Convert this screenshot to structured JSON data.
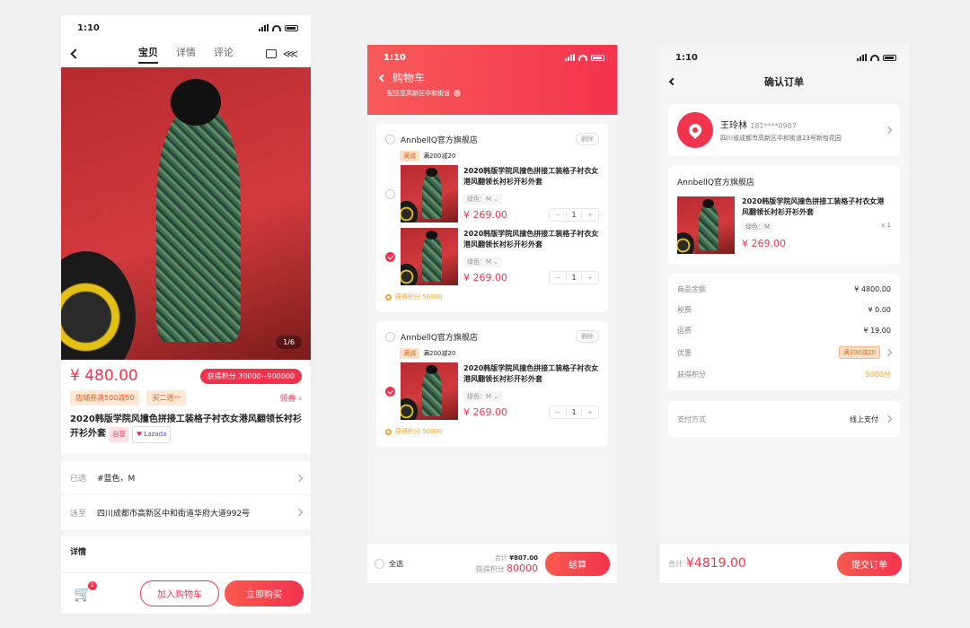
{
  "status": {
    "time": "1:10"
  },
  "product": {
    "tabs": [
      "宝贝",
      "详情",
      "评论"
    ],
    "image_counter": "1/6",
    "price": "¥ 480.00",
    "points_badge": "获得积分 30000~900000",
    "coupons": [
      "店铺券满500减50",
      "买二送一"
    ],
    "coupon_link": "领券",
    "title": "2020韩版学院风撞色拼接工装格子衬衣女港风翻领长衬衫开衫外套",
    "self_tag": "自营",
    "brand_tag": "Lazada",
    "selected_label": "已选",
    "selected_value": "#蓝色，M",
    "ship_label": "送至",
    "ship_value": "四川成都市高新区中和街道华府大道992号",
    "details_title": "详情",
    "cart_badge": "2",
    "add_cart": "加入购物车",
    "buy_now": "立即购买"
  },
  "cart": {
    "title": "购物车",
    "deliver": "配送至高新区中和街道",
    "stores": [
      {
        "name": "AnnbellQ官方旗舰店",
        "delete": "删除",
        "promo_tag": "满减",
        "promo_text": "满200减20",
        "items": [
          {
            "title": "2020韩版学院风撞色拼接工装格子衬衣女港风翻领长衬衫开衫外套",
            "spec": "绿色：M",
            "price": "¥ 269.00",
            "qty": "1",
            "checked": false
          },
          {
            "title": "2020韩版学院风撞色拼接工装格子衬衣女港风翻领长衬衫开衫外套",
            "spec": "绿色：M",
            "price": "¥ 269.00",
            "qty": "1",
            "checked": true
          }
        ],
        "points": "获得积分 50000"
      },
      {
        "name": "AnnbellQ官方旗舰店",
        "delete": "删除",
        "promo_tag": "满减",
        "promo_text": "满200减20",
        "items": [
          {
            "title": "2020韩版学院风撞色拼接工装格子衬衣女港风翻领长衬衫开衫外套",
            "spec": "绿色：M",
            "price": "¥ 269.00",
            "qty": "1",
            "checked": true
          }
        ],
        "points": "获得积分 50000"
      }
    ],
    "select_all": "全选",
    "total_label": "合计",
    "total": "¥807.00",
    "points_label": "获得积分",
    "points_total": "80000",
    "checkout": "结算"
  },
  "order": {
    "title": "确认订单",
    "name": "王玲林",
    "phone": "181****0987",
    "address": "四川省成都市高新区中和街道23号新怡花园",
    "store": "AnnbellQ官方旗舰店",
    "item_title": "2020韩版学院风撞色拼接工装格子衬衣女港风翻领长衬衫开衫外套",
    "item_spec": "绿色：M",
    "item_qty": "x 1",
    "item_price": "¥ 269.00",
    "fees": [
      {
        "label": "商品金额",
        "value": "¥ 4800.00"
      },
      {
        "label": "税费",
        "value": "¥ 0.00"
      },
      {
        "label": "运费",
        "value": "¥ 19.00"
      }
    ],
    "discount_label": "优惠",
    "discount_value": "满200减20",
    "points_label": "获得积分",
    "points_value": "5000分",
    "pay_label": "支付方式",
    "pay_value": "线上支付",
    "total_label": "合计",
    "total": "¥4819.00",
    "submit": "提交订单"
  }
}
